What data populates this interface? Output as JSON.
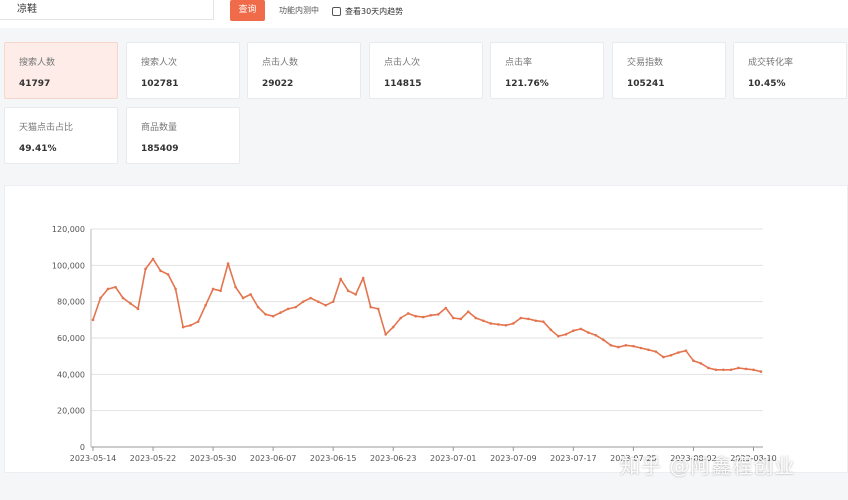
{
  "search": {
    "value": "凉鞋",
    "button_label": "查询"
  },
  "function_text": "功能内测中",
  "trend_toggle_label": "查看30天内趋势",
  "metrics": [
    {
      "label": "搜索人数",
      "value": "41797",
      "active": true
    },
    {
      "label": "搜索人次",
      "value": "102781"
    },
    {
      "label": "点击人数",
      "value": "29022"
    },
    {
      "label": "点击人次",
      "value": "114815"
    },
    {
      "label": "点击率",
      "value": "121.76%"
    },
    {
      "label": "交易指数",
      "value": "105241"
    },
    {
      "label": "成交转化率",
      "value": "10.45%"
    },
    {
      "label": "天猫点击占比",
      "value": "49.41%"
    },
    {
      "label": "商品数量",
      "value": "185409"
    }
  ],
  "watermark": "知乎 @阿鑫程创业",
  "colors": {
    "accent": "#ef6b4a",
    "line": "#e4744e",
    "active_card_bg": "#fdece8"
  },
  "chart_data": {
    "type": "line",
    "title": "",
    "xlabel": "",
    "ylabel": "",
    "ylim": [
      0,
      120000
    ],
    "y_ticks": [
      "0",
      "20,000",
      "40,000",
      "60,000",
      "80,000",
      "100,000",
      "120,000"
    ],
    "x_ticks": [
      "2023-05-14",
      "2023-05-22",
      "2023-05-30",
      "2023-06-07",
      "2023-06-15",
      "2023-06-23",
      "2023-07-01",
      "2023-07-09",
      "2023-07-17",
      "2023-07-25",
      "2023-08-02",
      "2023-08-10"
    ],
    "grid": true,
    "series": [
      {
        "values": [
          70000,
          82000,
          87000,
          88000,
          82000,
          79000,
          76000,
          98000,
          103500,
          97000,
          95000,
          87000,
          66000,
          67000,
          69000,
          78000,
          87000,
          86000,
          101000,
          88000,
          82000,
          84000,
          77000,
          73000,
          72000,
          74000,
          76000,
          77000,
          80000,
          82000,
          80000,
          78000,
          80000,
          92500,
          86000,
          84000,
          93000,
          77000,
          76000,
          62000,
          66000,
          71000,
          73500,
          72000,
          71500,
          72500,
          73000,
          76500,
          71000,
          70500,
          74500,
          71000,
          69500,
          68000,
          67500,
          67000,
          68000,
          71000,
          70500,
          69500,
          69000,
          64500,
          61000,
          62000,
          64000,
          65000,
          63000,
          61500,
          59000,
          56000,
          55000,
          56000,
          55500,
          54500,
          53500,
          52500,
          49500,
          50500,
          52000,
          53000,
          47500,
          46000,
          43500,
          42500,
          42500,
          42500,
          43500,
          43000,
          42500,
          41500
        ]
      }
    ]
  }
}
